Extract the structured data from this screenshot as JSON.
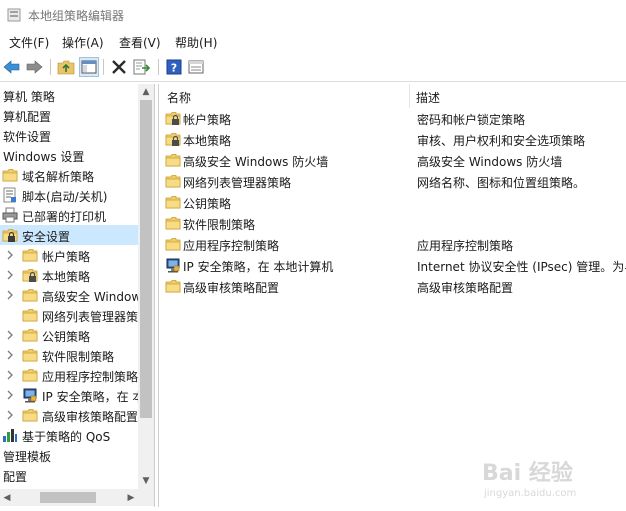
{
  "window": {
    "title": "本地组策略编辑器"
  },
  "menu": [
    {
      "label": "文件(F)"
    },
    {
      "label": "操作(A)"
    },
    {
      "label": "查看(V)"
    },
    {
      "label": "帮助(H)"
    }
  ],
  "tree": [
    {
      "label": "算机 策略",
      "icon": "none",
      "level": 0
    },
    {
      "label": "算机配置",
      "icon": "none",
      "level": 0
    },
    {
      "label": "软件设置",
      "icon": "none",
      "level": 0
    },
    {
      "label": "Windows 设置",
      "icon": "none",
      "level": 0
    },
    {
      "label": "域名解析策略",
      "icon": "folder-icon",
      "level": 1
    },
    {
      "label": "脚本(启动/关机)",
      "icon": "script-icon",
      "level": 1
    },
    {
      "label": "已部署的打印机",
      "icon": "printer-icon",
      "level": 1
    },
    {
      "label": "安全设置",
      "icon": "security-folder-icon",
      "level": 1,
      "selected": true
    },
    {
      "label": "帐户策略",
      "icon": "folder-icon",
      "level": 2,
      "arrow": true
    },
    {
      "label": "本地策略",
      "icon": "locked-folder-icon",
      "level": 2,
      "arrow": true
    },
    {
      "label": "高级安全 Windows",
      "icon": "folder-icon",
      "level": 2,
      "arrow": true
    },
    {
      "label": "网络列表管理器策",
      "icon": "folder-icon",
      "level": 2
    },
    {
      "label": "公钥策略",
      "icon": "folder-icon",
      "level": 2,
      "arrow": true
    },
    {
      "label": "软件限制策略",
      "icon": "folder-icon",
      "level": 2,
      "arrow": true
    },
    {
      "label": "应用程序控制策略",
      "icon": "folder-icon",
      "level": 2,
      "arrow": true
    },
    {
      "label": "IP 安全策略，在 本",
      "icon": "ipsec-icon",
      "level": 2,
      "arrow": true
    },
    {
      "label": "高级审核策略配置",
      "icon": "folder-icon",
      "level": 2,
      "arrow": true
    },
    {
      "label": "基于策略的 QoS",
      "icon": "chart-icon",
      "level": 0
    },
    {
      "label": "管理模板",
      "icon": "none",
      "level": 0
    },
    {
      "label": "配置",
      "icon": "none",
      "level": 0
    }
  ],
  "list": {
    "columns": {
      "name": "名称",
      "description": "描述"
    },
    "rows": [
      {
        "name": "帐户策略",
        "description": "密码和帐户锁定策略",
        "icon": "locked-folder-icon"
      },
      {
        "name": "本地策略",
        "description": "审核、用户权利和安全选项策略",
        "icon": "locked-folder-icon"
      },
      {
        "name": "高级安全 Windows 防火墙",
        "description": "高级安全 Windows 防火墙",
        "icon": "folder-icon"
      },
      {
        "name": "网络列表管理器策略",
        "description": "网络名称、图标和位置组策略。",
        "icon": "folder-icon"
      },
      {
        "name": "公钥策略",
        "description": "",
        "icon": "folder-icon"
      },
      {
        "name": "软件限制策略",
        "description": "",
        "icon": "folder-icon"
      },
      {
        "name": "应用程序控制策略",
        "description": "应用程序控制策略",
        "icon": "folder-icon"
      },
      {
        "name": "IP 安全策略，在 本地计算机",
        "description": "Internet 协议安全性 (IPsec) 管理。为与",
        "icon": "ipsec-icon"
      },
      {
        "name": "高级审核策略配置",
        "description": "高级审核策略配置",
        "icon": "folder-icon"
      }
    ]
  },
  "watermark": {
    "text": "Bai 经验",
    "subtext": "jingyan.baidu.com"
  }
}
